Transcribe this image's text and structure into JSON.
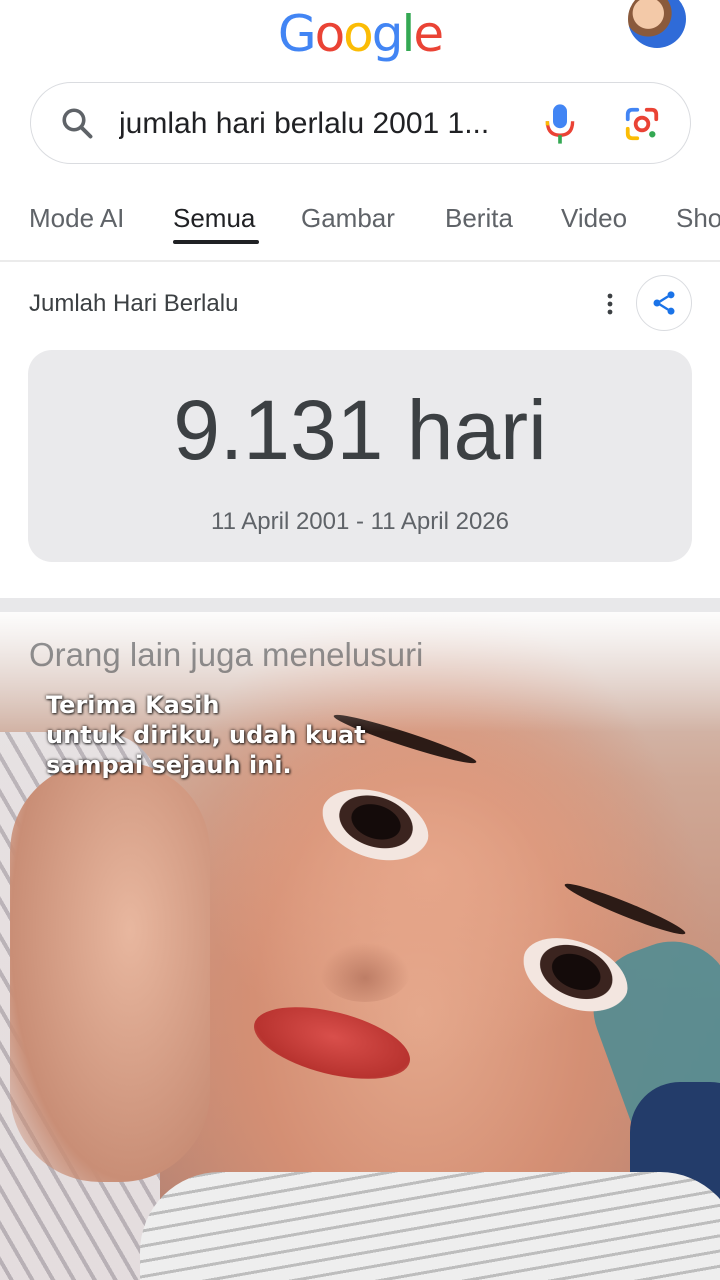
{
  "header": {
    "logo_letters": [
      {
        "char": "G",
        "color": "#4285F4"
      },
      {
        "char": "o",
        "color": "#EA4335"
      },
      {
        "char": "o",
        "color": "#FBBC05"
      },
      {
        "char": "g",
        "color": "#4285F4"
      },
      {
        "char": "l",
        "color": "#34A853"
      },
      {
        "char": "e",
        "color": "#EA4335"
      }
    ]
  },
  "search": {
    "query": "jumlah hari berlalu 2001 1..."
  },
  "tabs": [
    {
      "label": "Mode AI",
      "active": false
    },
    {
      "label": "Semua",
      "active": true
    },
    {
      "label": "Gambar",
      "active": false
    },
    {
      "label": "Berita",
      "active": false
    },
    {
      "label": "Video",
      "active": false
    },
    {
      "label": "Sho",
      "active": false
    }
  ],
  "result_card": {
    "title": "Jumlah Hari Berlalu",
    "value": "9.131 hari",
    "range": "11 April 2001 - 11 April 2026"
  },
  "next_section": {
    "heading": "Orang lain juga menelusuri"
  },
  "overlay_caption": {
    "lines": [
      "Terima Kasih",
      "untuk diriku, udah kuat",
      "sampai sejauh ini."
    ]
  },
  "colors": {
    "google_blue": "#4285F4",
    "google_red": "#EA4335",
    "google_yellow": "#FBBC05",
    "google_green": "#34A853",
    "share_blue": "#1a73e8"
  },
  "icons": {
    "search": "search-icon",
    "mic": "mic-icon",
    "lens": "google-lens-icon",
    "more": "more-vert-icon",
    "share": "share-icon"
  }
}
